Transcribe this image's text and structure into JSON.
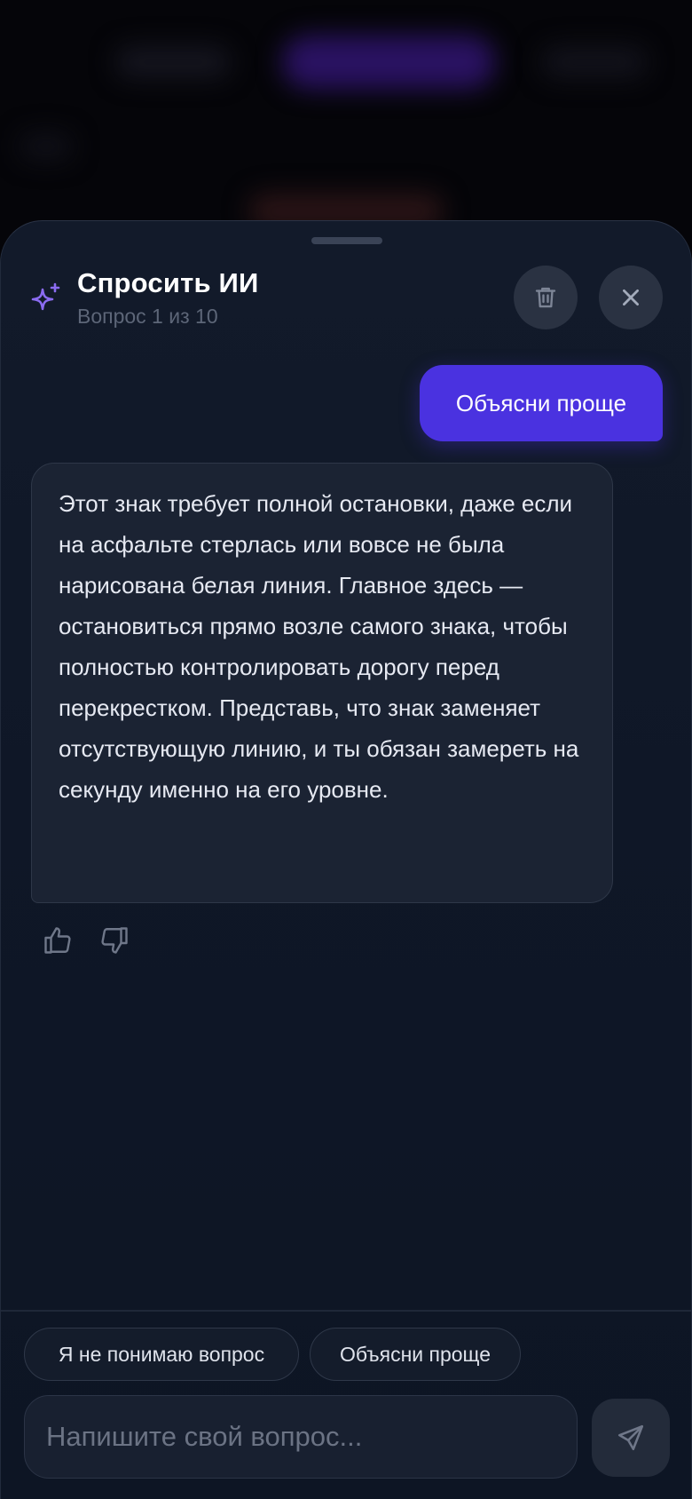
{
  "header": {
    "title": "Спросить ИИ",
    "subtitle": "Вопрос 1 из 10",
    "icons": {
      "assistant": "sparkle-icon",
      "clear": "trash-icon",
      "close": "close-icon"
    }
  },
  "messages": {
    "user_message": "Объясни проще",
    "ai_message": "Этот знак требует полной остановки, даже если на асфальте стерлась или вовсе не была нарисована белая линия. Главное здесь — остановиться прямо возле самого знака, чтобы полностью контролировать дорогу перед перекрестком. Представь, что знак заменяет отсутствующую линию, и ты обязан замереть на секунду именно на его уровне."
  },
  "feedback": {
    "like_icon": "thumbs-up-icon",
    "dislike_icon": "thumbs-down-icon"
  },
  "quick_replies": [
    "Я не понимаю вопрос",
    "Объясни проще"
  ],
  "composer": {
    "placeholder": "Напишите свой вопрос...",
    "value": "",
    "send_icon": "send-icon"
  },
  "colors": {
    "accent": "#4a32e0",
    "sparkle": "#8b6cf2",
    "sheet_bg": "#101828",
    "bubble_bg": "#1b2333"
  }
}
